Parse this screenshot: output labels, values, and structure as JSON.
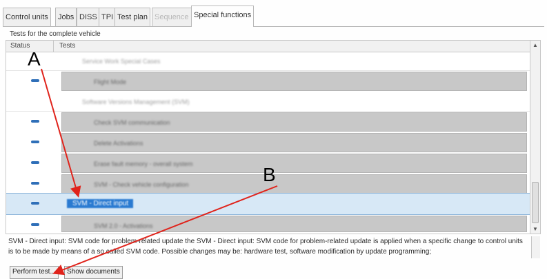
{
  "tabs": [
    {
      "label": "Control units",
      "state": "normal"
    },
    {
      "label": "Jobs",
      "state": "normal"
    },
    {
      "label": "DISS",
      "state": "normal"
    },
    {
      "label": "TPI",
      "state": "normal"
    },
    {
      "label": "Test plan",
      "state": "normal"
    },
    {
      "label": "Sequence",
      "state": "disabled"
    },
    {
      "label": "Special functions",
      "state": "active"
    }
  ],
  "panel": {
    "title": "Tests for the complete vehicle"
  },
  "table": {
    "columns": {
      "status": "Status",
      "tests": "Tests"
    },
    "rows": [
      {
        "kind": "group",
        "label": "Service Work Special Cases"
      },
      {
        "kind": "test",
        "label": "Flight Mode"
      },
      {
        "kind": "group",
        "label": "Software Versions Management (SVM)"
      },
      {
        "kind": "test",
        "label": "Check SVM communication"
      },
      {
        "kind": "test",
        "label": "Delete Activations"
      },
      {
        "kind": "test",
        "label": "Erase fault memory - overall system"
      },
      {
        "kind": "test",
        "label": "SVM - Check vehicle configuration"
      },
      {
        "kind": "test",
        "label": "SVM - Direct input",
        "selected": true
      },
      {
        "kind": "test",
        "label": "SVM 2.0 - Activations"
      }
    ]
  },
  "description": "SVM - Direct input: SVM code for problem-related update the SVM - Direct input: SVM code for problem-related update is applied when a specific change to control units is to be made by means of a so called SVM code. Possible changes may be: hardware test, software modification by update programming;",
  "buttons": {
    "perform": "Perform test...",
    "show_docs": "Show documents"
  },
  "annotations": {
    "a": "A",
    "b": "B",
    "arrow_color": "#e0231b"
  },
  "colors": {
    "status_indicator": "#2f6fb8",
    "selection": "#2a7ad1",
    "selected_row": "#d7e8f6"
  }
}
